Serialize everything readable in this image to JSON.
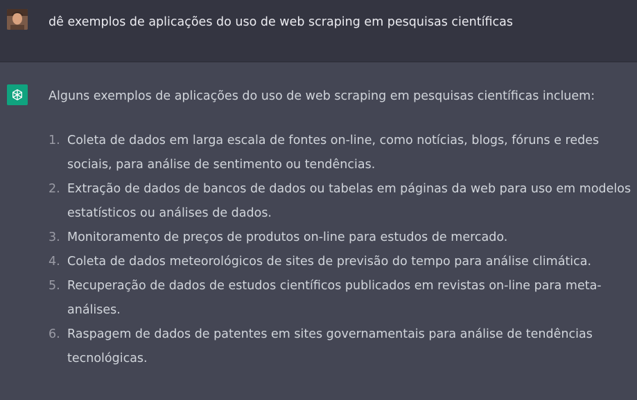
{
  "user_message": {
    "text": "dê exemplos de aplicações do uso de web scraping em pesquisas científicas"
  },
  "assistant_message": {
    "intro": "Alguns exemplos de aplicações do uso de web scraping em pesquisas científicas incluem:",
    "items": [
      {
        "number": "1.",
        "line1": "Coleta de dados em larga escala de fontes on-line, como notícias, blogs, fóruns e redes",
        "line2": "sociais, para análise de sentimento ou tendências."
      },
      {
        "number": "2.",
        "line1": "Extração de dados de bancos de dados ou tabelas em páginas da web para uso em modelos",
        "line2": "estatísticos ou análises de dados."
      },
      {
        "number": "3.",
        "line1": "Monitoramento de preços de produtos on-line para estudos de mercado.",
        "line2": ""
      },
      {
        "number": "4.",
        "line1": "Coleta de dados meteorológicos de sites de previsão do tempo para análise climática.",
        "line2": ""
      },
      {
        "number": "5.",
        "line1": "Recuperação de dados de estudos científicos publicados em revistas on-line para meta-",
        "line2": "análises."
      },
      {
        "number": "6.",
        "line1": "Raspagem de dados de patentes em sites governamentais para análise de tendências",
        "line2": "tecnológicas."
      }
    ]
  },
  "colors": {
    "user_bg": "#343541",
    "assistant_bg": "#444654",
    "accent": "#10a37f"
  },
  "icons": {
    "user": "user-avatar-photo",
    "assistant": "openai-logo-icon"
  }
}
